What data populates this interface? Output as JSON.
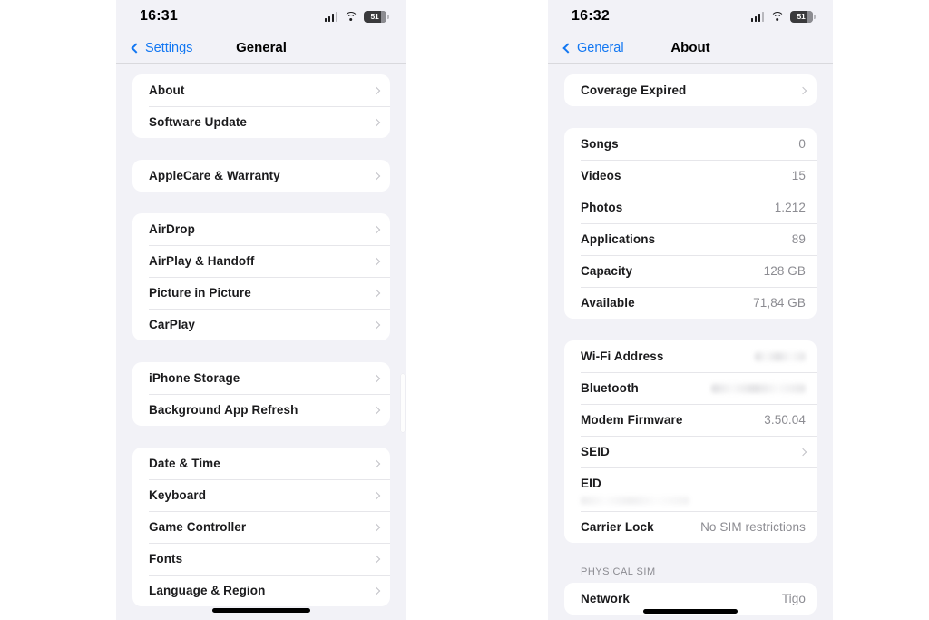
{
  "left_phone": {
    "status_bar": {
      "time": "16:31",
      "cellular_icon": "cellular-signal-icon",
      "wifi_icon": "wifi-icon",
      "battery_icon": "battery-icon",
      "battery_level": "51"
    },
    "nav": {
      "back_label": "Settings",
      "back_icon": "chevron-left-icon",
      "title": "General"
    },
    "groups": [
      {
        "rows": [
          {
            "label": "About",
            "value": "",
            "chevron": true
          },
          {
            "label": "Software Update",
            "value": "",
            "chevron": true
          }
        ]
      },
      {
        "rows": [
          {
            "label": "AppleCare & Warranty",
            "value": "",
            "chevron": true
          }
        ]
      },
      {
        "rows": [
          {
            "label": "AirDrop",
            "value": "",
            "chevron": true
          },
          {
            "label": "AirPlay & Handoff",
            "value": "",
            "chevron": true
          },
          {
            "label": "Picture in Picture",
            "value": "",
            "chevron": true
          },
          {
            "label": "CarPlay",
            "value": "",
            "chevron": true
          }
        ]
      },
      {
        "rows": [
          {
            "label": "iPhone Storage",
            "value": "",
            "chevron": true
          },
          {
            "label": "Background App Refresh",
            "value": "",
            "chevron": true
          }
        ]
      },
      {
        "rows": [
          {
            "label": "Date & Time",
            "value": "",
            "chevron": true
          },
          {
            "label": "Keyboard",
            "value": "",
            "chevron": true
          },
          {
            "label": "Game Controller",
            "value": "",
            "chevron": true
          },
          {
            "label": "Fonts",
            "value": "",
            "chevron": true
          },
          {
            "label": "Language & Region",
            "value": "",
            "chevron": true
          }
        ]
      }
    ]
  },
  "right_phone": {
    "status_bar": {
      "time": "16:32",
      "cellular_icon": "cellular-signal-icon",
      "wifi_icon": "wifi-icon",
      "battery_icon": "battery-icon",
      "battery_level": "51"
    },
    "nav": {
      "back_label": "General",
      "back_icon": "chevron-left-icon",
      "title": "About"
    },
    "groups": [
      {
        "rows": [
          {
            "label": "Coverage Expired",
            "value": "",
            "chevron": true
          }
        ]
      },
      {
        "rows": [
          {
            "label": "Songs",
            "value": "0",
            "chevron": false
          },
          {
            "label": "Videos",
            "value": "15",
            "chevron": false
          },
          {
            "label": "Photos",
            "value": "1.212",
            "chevron": false
          },
          {
            "label": "Applications",
            "value": "89",
            "chevron": false
          },
          {
            "label": "Capacity",
            "value": "128 GB",
            "chevron": false
          },
          {
            "label": "Available",
            "value": "71,84 GB",
            "chevron": false
          }
        ]
      },
      {
        "rows": [
          {
            "label": "Wi-Fi Address",
            "value": "",
            "chevron": false,
            "redacted": true
          },
          {
            "label": "Bluetooth",
            "value": "",
            "chevron": false,
            "redacted": true
          },
          {
            "label": "Modem Firmware",
            "value": "3.50.04",
            "chevron": false
          },
          {
            "label": "SEID",
            "value": "",
            "chevron": true
          },
          {
            "label": "EID",
            "value": "",
            "chevron": false,
            "redacted": true
          },
          {
            "label": "Carrier Lock",
            "value": "No SIM restrictions",
            "chevron": false
          }
        ]
      }
    ],
    "physical_sim_header": "PHYSICAL SIM",
    "physical_sim_rows": [
      {
        "label": "Network",
        "value": "Tigo",
        "chevron": false
      }
    ]
  }
}
